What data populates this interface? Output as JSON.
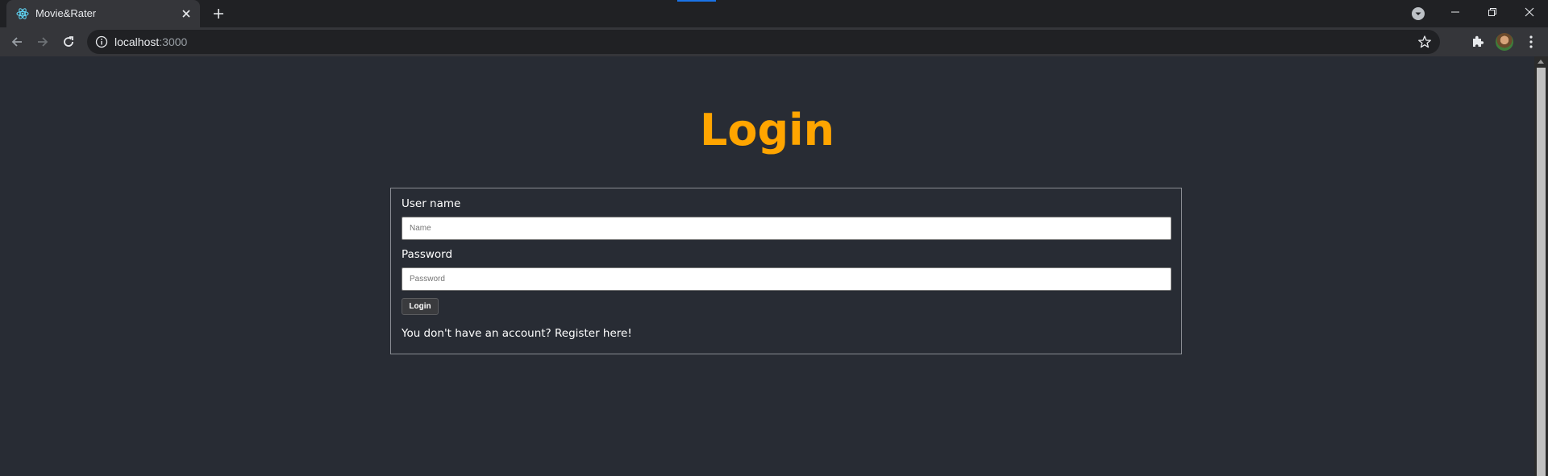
{
  "browser": {
    "tab_title": "Movie&Rater",
    "url_host": "localhost",
    "url_port": ":3000"
  },
  "page": {
    "heading": "Login",
    "form": {
      "username_label": "User name",
      "username_placeholder": "Name",
      "password_label": "Password",
      "password_placeholder": "Password",
      "submit_label": "Login",
      "register_prompt": "You don't have an account?",
      "register_link": "Register here!"
    }
  },
  "colors": {
    "page_bg": "#282c34",
    "heading": "#ffa500",
    "chrome_dark": "#202124",
    "chrome_toolbar": "#35363a",
    "accent": "#1a73e8"
  },
  "icons": [
    "react-logo-icon",
    "close-icon",
    "plus-icon",
    "tab-search-icon",
    "minimize-icon",
    "restore-icon",
    "back-icon",
    "forward-icon",
    "reload-icon",
    "info-icon",
    "star-icon",
    "extensions-icon",
    "avatar",
    "kebab-menu-icon"
  ]
}
